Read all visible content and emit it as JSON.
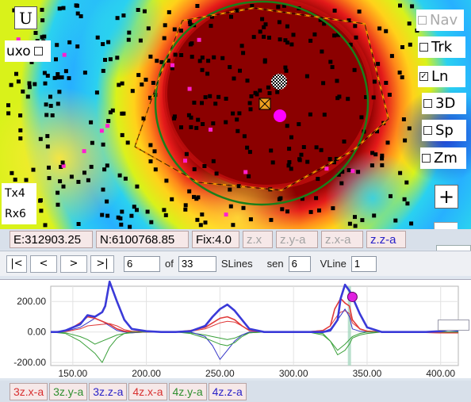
{
  "map": {
    "u_button": "U",
    "uxo_label": "uxo",
    "toggles": [
      {
        "key": "nav",
        "label": "Nav",
        "checked": false,
        "enabled": false
      },
      {
        "key": "trk",
        "label": "Trk",
        "checked": false,
        "enabled": true
      },
      {
        "key": "ln",
        "label": "Ln",
        "checked": true,
        "enabled": true
      },
      {
        "key": "3d",
        "label": "3D",
        "checked": false,
        "enabled": true
      },
      {
        "key": "sp",
        "label": "Sp",
        "checked": false,
        "enabled": true
      },
      {
        "key": "zm",
        "label": "Zm",
        "checked": false,
        "enabled": true
      }
    ],
    "plus_button": "+",
    "tx_label": "Tx4",
    "rx_label": "Rx6",
    "colors": {
      "anomaly_core": "#8b0000",
      "circle": "#1a7f1a",
      "polygon": "#f08c00",
      "target_marker": "#ff00ff",
      "station_dots": "#000000",
      "alt_dots": "#ff1fd0"
    }
  },
  "status": {
    "easting": "E:312903.25",
    "northing": "N:6100768.85",
    "fix": "Fix:4.0",
    "channels": [
      {
        "label": "z.x",
        "state": "dim"
      },
      {
        "label": "z.y-a",
        "state": "dim"
      },
      {
        "label": "z.x-a",
        "state": "dim"
      },
      {
        "label": "z.z-a",
        "state": "active"
      }
    ]
  },
  "nav": {
    "first": "|<",
    "prev": "<",
    "next": ">",
    "last": ">|",
    "line_value": "6",
    "of_label": "of",
    "total_value": "33",
    "slines_label": "SLines",
    "sen_label": "sen",
    "sen_value": "6",
    "vline_label": "VLine",
    "vline_value": "1"
  },
  "chart_data": {
    "type": "line",
    "xlim": [
      135,
      412
    ],
    "ylim": [
      -220,
      300
    ],
    "x_ticks": [
      "150.00",
      "200.00",
      "250.00",
      "300.00",
      "350.00",
      "400.00"
    ],
    "y_ticks": [
      "200.00",
      "0.00",
      "-200.00"
    ],
    "cursor_x": 338,
    "marker": {
      "x": 340,
      "y": 230
    },
    "series": [
      {
        "name": "3z.x-a",
        "color": "#e03a3a",
        "width": 1,
        "x": [
          135,
          145,
          155,
          160,
          165,
          170,
          175,
          180,
          185,
          190,
          200,
          210,
          220,
          230,
          240,
          245,
          250,
          255,
          260,
          265,
          270,
          280,
          290,
          300,
          310,
          320,
          325,
          330,
          332,
          335,
          338,
          340,
          345,
          350,
          360,
          380,
          400,
          412
        ],
        "values": [
          0,
          2,
          20,
          40,
          45,
          50,
          55,
          40,
          15,
          5,
          2,
          0,
          0,
          5,
          20,
          40,
          60,
          70,
          65,
          40,
          10,
          2,
          0,
          0,
          2,
          10,
          40,
          110,
          130,
          140,
          120,
          60,
          20,
          5,
          0,
          -2,
          -5,
          -5
        ]
      },
      {
        "name": "3z.y-a",
        "color": "#3aa03a",
        "width": 1,
        "x": [
          135,
          145,
          155,
          160,
          165,
          170,
          175,
          180,
          185,
          190,
          200,
          210,
          220,
          230,
          240,
          245,
          250,
          255,
          260,
          265,
          270,
          280,
          290,
          300,
          310,
          320,
          325,
          330,
          335,
          338,
          340,
          345,
          350,
          360,
          380,
          400,
          412
        ],
        "values": [
          0,
          -5,
          -30,
          -50,
          -80,
          -60,
          -40,
          -20,
          -10,
          -5,
          0,
          0,
          0,
          -5,
          -20,
          -30,
          -40,
          -50,
          -40,
          -20,
          -5,
          0,
          0,
          0,
          0,
          -20,
          -60,
          -150,
          -120,
          -80,
          -40,
          -20,
          -10,
          0,
          0,
          0,
          0
        ]
      },
      {
        "name": "3z.z-a",
        "color": "#3636c8",
        "width": 1,
        "x": [
          135,
          145,
          155,
          160,
          165,
          170,
          175,
          180,
          185,
          190,
          200,
          210,
          220,
          230,
          240,
          245,
          250,
          255,
          260,
          265,
          270,
          280,
          290,
          300,
          310,
          320,
          325,
          330,
          335,
          338,
          340,
          345,
          350,
          360,
          380,
          400,
          412
        ],
        "values": [
          0,
          5,
          30,
          60,
          90,
          70,
          40,
          10,
          0,
          -5,
          0,
          0,
          0,
          0,
          -30,
          -90,
          -180,
          -120,
          -60,
          -20,
          0,
          0,
          0,
          0,
          0,
          0,
          20,
          80,
          150,
          100,
          20,
          5,
          0,
          0,
          0,
          0,
          0
        ]
      },
      {
        "name": "4z.x-a",
        "color": "#e03a3a",
        "width": 1.6,
        "x": [
          135,
          145,
          150,
          155,
          160,
          165,
          170,
          175,
          180,
          185,
          190,
          200,
          210,
          220,
          230,
          240,
          245,
          250,
          255,
          260,
          265,
          270,
          280,
          290,
          300,
          310,
          320,
          325,
          328,
          332,
          335,
          338,
          340,
          345,
          350,
          360,
          380,
          400,
          412
        ],
        "values": [
          0,
          5,
          30,
          60,
          100,
          90,
          70,
          50,
          20,
          5,
          0,
          0,
          0,
          0,
          10,
          30,
          60,
          90,
          100,
          80,
          40,
          10,
          0,
          0,
          0,
          0,
          10,
          40,
          150,
          220,
          190,
          170,
          80,
          20,
          5,
          0,
          0,
          -5,
          -5
        ]
      },
      {
        "name": "4z.y-a",
        "color": "#3aa03a",
        "width": 1,
        "x": [
          135,
          145,
          155,
          160,
          165,
          170,
          175,
          180,
          185,
          190,
          200,
          210,
          220,
          230,
          240,
          245,
          250,
          255,
          260,
          265,
          270,
          280,
          290,
          300,
          310,
          320,
          325,
          330,
          335,
          340,
          345,
          350,
          360,
          380,
          400,
          412
        ],
        "values": [
          0,
          -10,
          -60,
          -100,
          -140,
          -200,
          -100,
          -40,
          -10,
          0,
          0,
          0,
          0,
          -10,
          -40,
          -60,
          -80,
          -90,
          -70,
          -30,
          -5,
          0,
          0,
          0,
          0,
          -10,
          -60,
          -120,
          -80,
          -30,
          -10,
          0,
          0,
          0,
          0,
          0
        ]
      },
      {
        "name": "4z.z-a",
        "color": "#3a3ad8",
        "width": 2.6,
        "x": [
          135,
          140,
          145,
          150,
          155,
          160,
          165,
          170,
          172,
          175,
          180,
          185,
          190,
          200,
          210,
          220,
          230,
          240,
          245,
          250,
          255,
          260,
          265,
          270,
          280,
          290,
          300,
          310,
          320,
          325,
          330,
          332,
          335,
          338,
          340,
          345,
          350,
          360,
          380,
          390,
          400,
          405,
          412
        ],
        "values": [
          0,
          0,
          10,
          30,
          50,
          110,
          100,
          130,
          170,
          330,
          200,
          80,
          20,
          5,
          0,
          0,
          5,
          40,
          100,
          150,
          180,
          140,
          80,
          20,
          0,
          0,
          0,
          0,
          0,
          10,
          80,
          220,
          310,
          270,
          230,
          120,
          30,
          0,
          0,
          0,
          5,
          15,
          10
        ]
      }
    ]
  },
  "legend": [
    {
      "label": "3z.x-a",
      "color": "#d83030"
    },
    {
      "label": "3z.y-a",
      "color": "#2f8f2f"
    },
    {
      "label": "3z.z-a",
      "color": "#2a22c8"
    },
    {
      "label": "4z.x-a",
      "color": "#d83030"
    },
    {
      "label": "4z.y-a",
      "color": "#2f8f2f"
    },
    {
      "label": "4z.z-a",
      "color": "#2a22c8"
    }
  ]
}
